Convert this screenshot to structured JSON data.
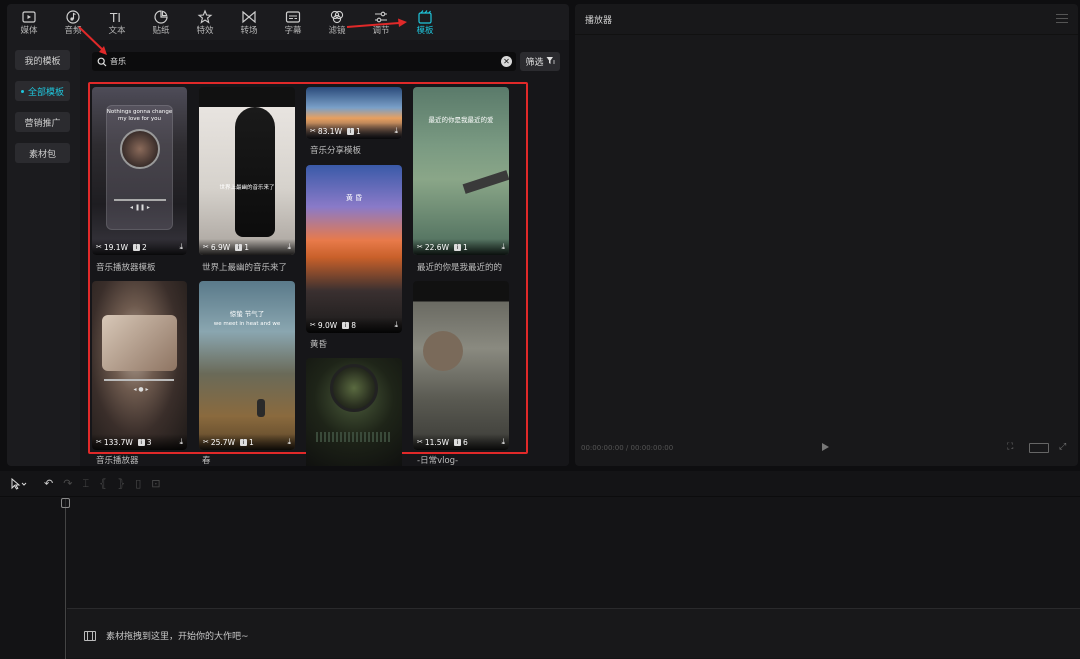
{
  "nav": {
    "items": [
      {
        "label": "媒体",
        "icon": "media-icon"
      },
      {
        "label": "音频",
        "icon": "audio-icon"
      },
      {
        "label": "文本",
        "icon": "text-icon"
      },
      {
        "label": "贴纸",
        "icon": "sticker-icon"
      },
      {
        "label": "特效",
        "icon": "effects-icon"
      },
      {
        "label": "转场",
        "icon": "transition-icon"
      },
      {
        "label": "字幕",
        "icon": "subtitle-icon"
      },
      {
        "label": "滤镜",
        "icon": "filter-icon"
      },
      {
        "label": "调节",
        "icon": "adjust-icon"
      },
      {
        "label": "模板",
        "icon": "template-icon",
        "active": true
      }
    ]
  },
  "sidebar": {
    "items": [
      {
        "label": "我的模板"
      },
      {
        "label": "全部模板",
        "active": true
      },
      {
        "label": "营销推广"
      },
      {
        "label": "素材包"
      }
    ]
  },
  "search": {
    "value": "音乐",
    "clear_glyph": "✕"
  },
  "filter": {
    "label": "筛选",
    "icon": "filter-funnel-icon"
  },
  "templates": [
    {
      "title": "音乐播放器模板",
      "uses": "19.1W",
      "clips": "2",
      "overlay": [
        "Nothings gonna change",
        "my love for you"
      ]
    },
    {
      "title": "世界上最幽的音乐来了",
      "uses": "6.9W",
      "clips": "1",
      "overlay": [
        "世界上最幽的音乐来了"
      ]
    },
    {
      "title": "音乐分享模板",
      "uses": "83.1W",
      "clips": "1",
      "overlay": []
    },
    {
      "title": "最近的你是我最近的的",
      "uses": "22.6W",
      "clips": "1",
      "overlay": [
        "最近的你是我最近的爱"
      ]
    },
    {
      "title": "音乐播放器",
      "uses": "133.7W",
      "clips": "3",
      "overlay": []
    },
    {
      "title": "春",
      "uses": "25.7W",
      "clips": "1",
      "overlay": [
        "惊蛰 节气了",
        "we meet in heat and we"
      ]
    },
    {
      "title": "黄昏",
      "uses": "9.0W",
      "clips": "8",
      "overlay": [
        "黄 昏"
      ]
    },
    {
      "title": "",
      "uses": "",
      "clips": "",
      "overlay": []
    },
    {
      "title": "-日常vlog-",
      "uses": "11.5W",
      "clips": "6",
      "overlay": []
    }
  ],
  "player": {
    "title": "播放器",
    "time": "00:00:00:00 / 00:00:00:00"
  },
  "timeline": {
    "hint": "素材拖拽到这里，开始你的大作吧~"
  },
  "colors": {
    "accent": "#1fc6dc",
    "highlight_border": "#e02929"
  }
}
